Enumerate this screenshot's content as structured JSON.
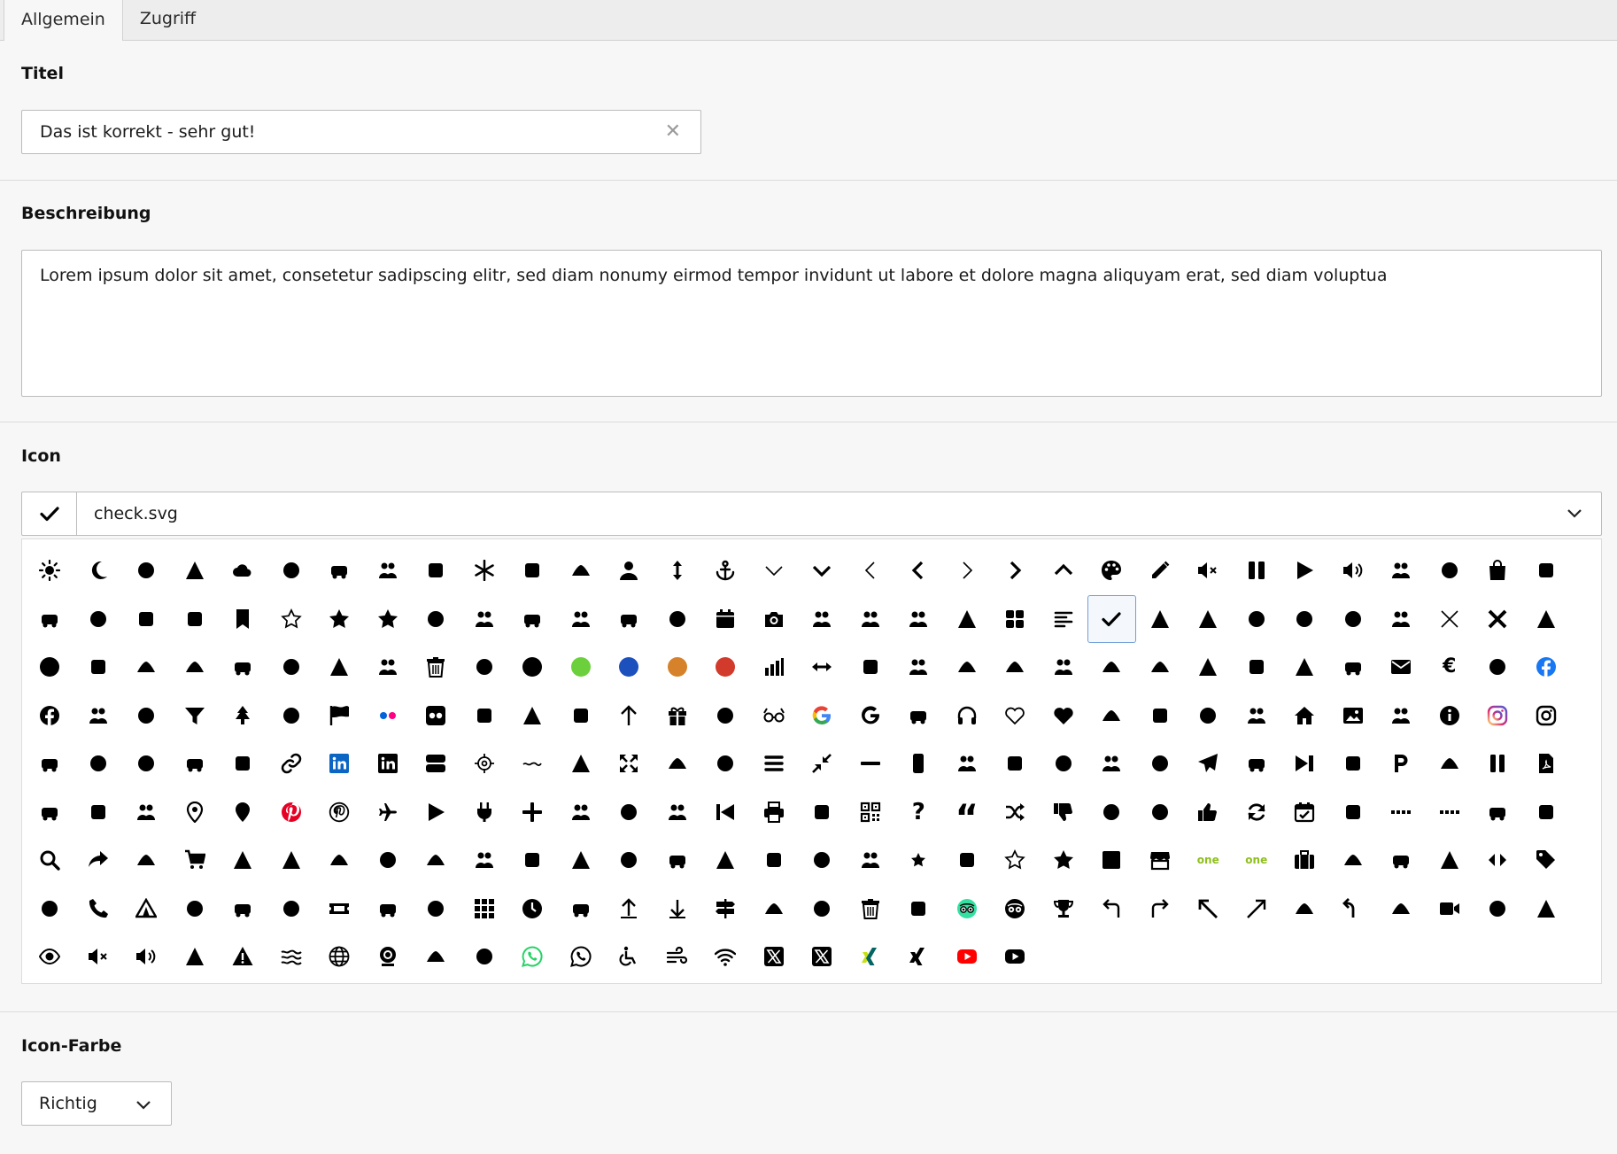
{
  "tabs": [
    {
      "label": "Allgemein",
      "active": true
    },
    {
      "label": "Zugriff",
      "active": false
    }
  ],
  "title_field": {
    "label": "Titel",
    "value": "Das ist korrekt - sehr gut!"
  },
  "description_field": {
    "label": "Beschreibung",
    "value": "Lorem ipsum dolor sit amet, consetetur sadipscing elitr, sed diam nonumy eirmod tempor invidunt ut labore et dolore magna aliquyam erat, sed diam voluptua"
  },
  "icon_field": {
    "label": "Icon",
    "selected_value": "check.svg",
    "selected_icon": "check-icon",
    "options": [
      "sun",
      "moon",
      "cloud-sun",
      "cloud-moon",
      "cloud",
      "clouds",
      "cloud-snow",
      "cloud-rain",
      "cloud-bolt",
      "snowflake",
      "360-view",
      "sun-snow",
      "user",
      "arrows-up-down",
      "anchor",
      "angle-down-thin",
      "angle-down",
      "angle-left-thin",
      "angle-left",
      "angle-right-thin",
      "angle-right",
      "angle-up",
      "palette",
      "pencil",
      "volume-mute",
      "pause",
      "play",
      "volume",
      "mountain-sun",
      "baby",
      "shopping-bag",
      "battery-full",
      "bicycle",
      "binoculars",
      "battery",
      "bed",
      "bookmark",
      "star-outline",
      "star",
      "star-bold",
      "wine-bottle",
      "book-open",
      "campfire",
      "bullhorn",
      "bullseye",
      "bus",
      "calendar",
      "camera",
      "caravan",
      "swimmer",
      "car",
      "hot-tub",
      "th-large",
      "align-left",
      "check",
      "glasses-cheers",
      "cheese",
      "chef-hat",
      "child",
      "people-tree",
      "building",
      "close-thin",
      "close",
      "cloud-small",
      "circle",
      "comment",
      "comments",
      "compass",
      "concierge-bell",
      "credit-card",
      "crown",
      "bank",
      "trash",
      "desktop",
      "circle-black",
      "circle-green",
      "circle-blue",
      "circle-orange",
      "circle-red",
      "chart-bar",
      "arrows-left-right",
      "stethoscope",
      "file-text",
      "dog",
      "hand-heart",
      "door",
      "download",
      "history",
      "utensils",
      "graduation-cap",
      "envelope-open-text",
      "envelope-open",
      "envelope",
      "euro",
      "microphone",
      "facebook-blue",
      "facebook",
      "family",
      "map",
      "filter",
      "tree",
      "fish",
      "flag",
      "flickr",
      "flickr-square",
      "flower",
      "gear",
      "toggle-knob",
      "arrow-up",
      "gift",
      "bucket",
      "glasses",
      "google-color",
      "google",
      "handshake",
      "headphones",
      "heart-outline",
      "heart",
      "hiking",
      "horse",
      "hotel",
      "factory",
      "home",
      "image",
      "images",
      "info",
      "instagram-color",
      "instagram",
      "podcast-circle",
      "pizza",
      "leaf",
      "lightbulb",
      "image-landscape",
      "link",
      "linkedin-blue",
      "linkedin",
      "square-bars",
      "crosshairs",
      "water-wave",
      "map-marked",
      "expand",
      "car-transfer",
      "kid",
      "bars",
      "compress",
      "minus",
      "mobile",
      "ship",
      "mug",
      "microphone-slash",
      "users",
      "users-group",
      "paper-plane",
      "newspaper",
      "step-forward",
      "outlook",
      "parking",
      "people-pair",
      "pause-alt",
      "file-pdf",
      "user-friends",
      "picasa",
      "aperture",
      "map-marker",
      "location",
      "pinterest-red",
      "pinterest",
      "plane",
      "play-bold",
      "plug",
      "plus",
      "podcast",
      "hand-point",
      "pool",
      "backward",
      "print",
      "radio",
      "qr-code",
      "question",
      "quote",
      "random",
      "thumbs-down",
      "thumbs-up-sparkle",
      "thumbs-up-star",
      "thumbs-up",
      "sync",
      "calendar-check",
      "recycle",
      "dots",
      "dots-wide",
      "playground",
      "scroll",
      "search",
      "share",
      "shipping",
      "shopping-cart",
      "skiing-nordic",
      "skiing",
      "ski-jump",
      "ski-jump-alt",
      "gondola",
      "sleigh",
      "snowboarding",
      "mountain-snow",
      "mountains-snow",
      "snowman",
      "soccer",
      "sort-amount",
      "spa",
      "squares",
      "star-small",
      "star-burst",
      "star-outline-alt",
      "star-solid",
      "square-solid",
      "store",
      "one-green",
      "one-green-alt",
      "suitcase",
      "sun-small",
      "chair-lift",
      "swimming",
      "code",
      "tag",
      "taxi",
      "phone",
      "tent",
      "threads-circle",
      "threads",
      "cloud-sun-bolt",
      "ticket",
      "tiktok-circle",
      "tiktok",
      "grid",
      "clock",
      "tools",
      "arrow-up-line",
      "arrow-down-line",
      "signpost",
      "train",
      "cable-car",
      "trash-alt",
      "tree-round",
      "tripadvisor-green",
      "tripadvisor",
      "trophy",
      "turn-left",
      "turn-right",
      "arrow-up-left",
      "arrow-up-right",
      "puzzle",
      "undo",
      "beach-umbrella",
      "video",
      "car-side",
      "walking-group",
      "eye",
      "volume-off",
      "volume-up",
      "walking",
      "warning",
      "water",
      "globe",
      "webcam",
      "car-front",
      "info-small",
      "whatsapp-green",
      "whatsapp",
      "wheelchair",
      "wind",
      "wifi",
      "x-twitter",
      "x-twitter-alt",
      "xing-green",
      "xing",
      "youtube-red",
      "youtube"
    ]
  },
  "color_field": {
    "label": "Icon-Farbe",
    "value": "Richtig"
  },
  "colors": {
    "green": "#6cd03c",
    "blue": "#1c50bd",
    "orange": "#d5822b",
    "red": "#d23a2b",
    "facebook": "#1877f2",
    "linkedin": "#0a66c2",
    "pinterest": "#e60023",
    "whatsapp": "#25d366",
    "youtube": "#ff0000",
    "xing": "#c6e011",
    "tripadvisor": "#34e0a1",
    "selection_border": "#6f9fd8"
  },
  "text_icons": {
    "one-green": "one",
    "one-green-alt": "one"
  }
}
